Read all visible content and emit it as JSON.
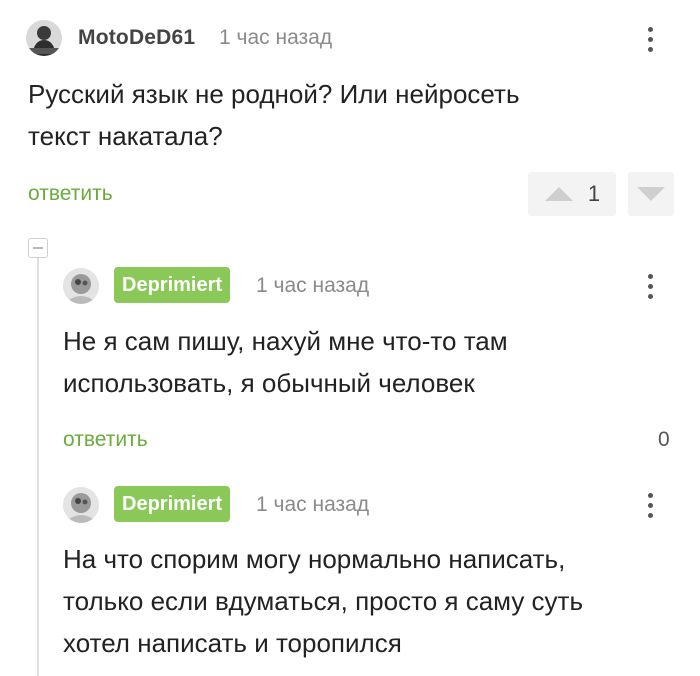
{
  "comments": [
    {
      "user": "MotoDeD61",
      "time": "1 час назад",
      "text_lines": [
        "Русский язык не родной? Или нейросеть",
        "текст накатала?"
      ],
      "reply_label": "ответить",
      "rating": "1"
    },
    {
      "user": "Deprimiert",
      "time": "1 час назад",
      "text_lines": [
        "Не я сам пишу, нахуй мне что-то там",
        "использовать, я обычный человек"
      ],
      "reply_label": "ответить",
      "rating": "0"
    },
    {
      "user": "Deprimiert",
      "time": "1 час назад",
      "text_lines": [
        "На что спорим могу нормально написать,",
        "только если вдуматься, просто я саму суть",
        "хотел написать и торопился"
      ]
    }
  ],
  "colors": {
    "accent_green": "#6aab3b",
    "badge_green": "#8ac858",
    "time_gray": "#8a8a8a"
  },
  "icons": [
    "avatar",
    "kebab-menu-icon",
    "upvote-icon",
    "downvote-icon",
    "collapse-icon"
  ]
}
